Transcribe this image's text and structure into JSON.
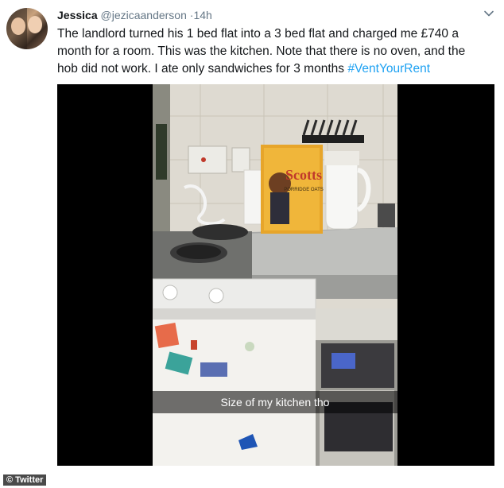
{
  "tweet": {
    "display_name": "Jessica",
    "handle": "@jezicaanderson",
    "dot": "·",
    "time": "14h",
    "text_before": "The landlord turned his 1 bed flat into a 3 bed flat and charged me £740 a month for a room. This was the kitchen. Note that there is no oven, and the hob did not work. I ate only sandwiches for 3 months ",
    "hashtag": "#VentYourRent"
  },
  "media": {
    "overlay_caption": "Size of my kitchen tho",
    "box_text": "Scotts",
    "box_subtext": "PORRIDGE OATS"
  },
  "credit": "© Twitter",
  "icons": {
    "menu": "chevron-down-icon",
    "avatar": "avatar"
  },
  "colors": {
    "link": "#1da1f2",
    "secondary_text": "#657786"
  }
}
